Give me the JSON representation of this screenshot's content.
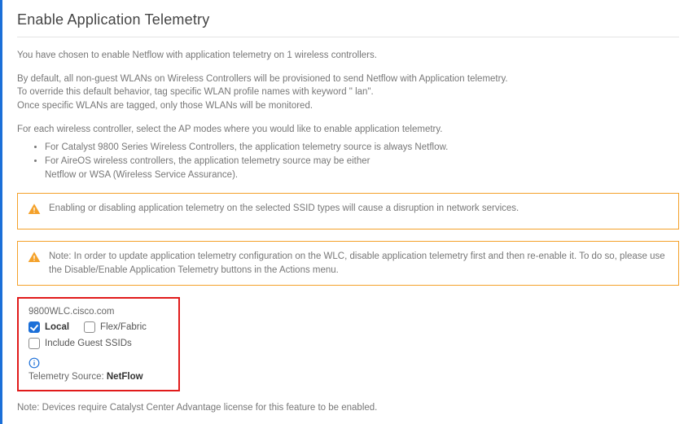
{
  "page": {
    "title": "Enable Application Telemetry"
  },
  "intro": {
    "line1": "You have chosen to enable Netflow with application telemetry on 1 wireless controllers.",
    "line2a": "By default, all non-guest WLANs on Wireless Controllers will be provisioned to send Netflow with Application telemetry.",
    "line2b": "To override this default behavior, tag specific WLAN profile names with keyword \" lan\".",
    "line2c": "Once specific WLANs are tagged, only those WLANs will be monitored.",
    "line3": "For each wireless controller, select the AP modes where you would like to enable application telemetry.",
    "bullet1": "For Catalyst 9800 Series Wireless Controllers, the application telemetry source is always Netflow.",
    "bullet2a": "For AireOS wireless controllers, the application telemetry source may be either",
    "bullet2b": "Netflow or WSA (Wireless Service Assurance)."
  },
  "alerts": {
    "a1": "Enabling or disabling application telemetry on the selected SSID types will cause a disruption in network services.",
    "a2": "Note: In order to update application telemetry configuration on the WLC, disable application telemetry first and then re-enable it. To do so, please use the Disable/Enable Application Telemetry buttons in the Actions menu."
  },
  "device": {
    "name": "9800WLC.cisco.com",
    "local_label": "Local",
    "flex_label": "Flex/Fabric",
    "guest_label": "Include Guest SSIDs",
    "local_checked": true,
    "flex_checked": false,
    "guest_checked": false,
    "telemetry_label": "Telemetry Source: ",
    "telemetry_value": "NetFlow"
  },
  "footer": {
    "note": "Note: Devices require Catalyst Center Advantage license for this feature to be enabled."
  },
  "icons": {
    "warning": "warning-icon",
    "info": "info-icon"
  }
}
